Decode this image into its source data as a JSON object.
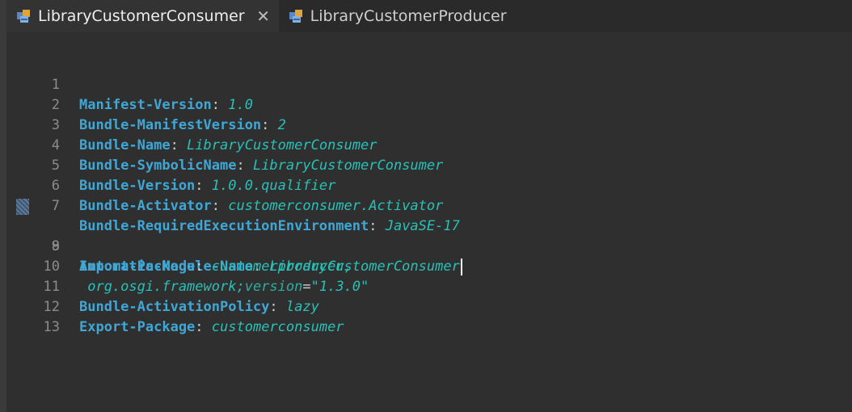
{
  "tabs": [
    {
      "label": "LibraryCustomerConsumer",
      "active": true,
      "close_glyph": "✕",
      "icon": "plugin-manifest-icon"
    },
    {
      "label": "LibraryCustomerProducer",
      "active": false,
      "icon": "plugin-manifest-icon"
    }
  ],
  "colors": {
    "background": "#2f2f2f",
    "key": "#3fa7d6",
    "value": "#27c1b8",
    "line_number": "#8c8c8c"
  },
  "editor": {
    "lines": [
      {
        "num": "1",
        "key": "Manifest-Version",
        "sep": ": ",
        "value": "1.0"
      },
      {
        "num": "2",
        "key": "Bundle-ManifestVersion",
        "sep": ": ",
        "value": "2"
      },
      {
        "num": "3",
        "key": "Bundle-Name",
        "sep": ": ",
        "value": "LibraryCustomerConsumer"
      },
      {
        "num": "4",
        "key": "Bundle-SymbolicName",
        "sep": ": ",
        "value": "LibraryCustomerConsumer"
      },
      {
        "num": "5",
        "key": "Bundle-Version",
        "sep": ": ",
        "value": "1.0.0.qualifier"
      },
      {
        "num": "6",
        "key": "Bundle-Activator",
        "sep": ": ",
        "value": "customerconsumer.Activator"
      },
      {
        "num": "7",
        "key": "Bundle-RequiredExecutionEnvironment",
        "sep": ": ",
        "value": "JavaSE-17"
      },
      {
        "num": "8",
        "key": "Automatic-Module-Name",
        "sep": ": ",
        "value": "LibraryCustomerConsumer"
      },
      {
        "num": "9",
        "key": "Import-Package",
        "sep": ": ",
        "value": "customerproducer,"
      },
      {
        "num": "10",
        "cont_prefix": " org.osgi.framework;",
        "attr": "version",
        "eq": "=",
        "str": "\"1.3.0\""
      },
      {
        "num": "11",
        "key": "Bundle-ActivationPolicy",
        "sep": ": ",
        "value": "lazy"
      },
      {
        "num": "12",
        "key": "Export-Package",
        "sep": ": ",
        "value": "customerconsumer"
      },
      {
        "num": "13"
      }
    ]
  }
}
